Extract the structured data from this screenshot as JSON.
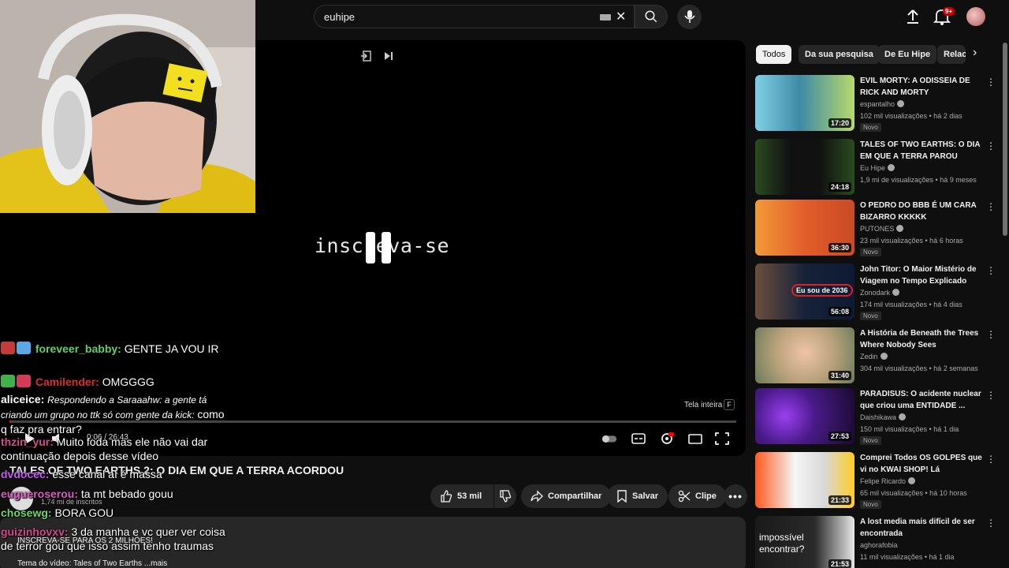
{
  "search": {
    "query": "euhipe"
  },
  "notifications": {
    "badge": "9+"
  },
  "player": {
    "overlay_text": "inscreva-se",
    "fullscreen_hint": "Tela inteira",
    "fullscreen_key": "F",
    "time": "0:06 / 26:43"
  },
  "video": {
    "title": "TALES OF TWO EARTHS 2: O DIA EM QUE A TERRA ACORDOU",
    "subscribers": "1,74 mi de inscritos",
    "likes": "53 mil",
    "share_label": "Compartilhar",
    "save_label": "Salvar",
    "clip_label": "Clipe"
  },
  "description": {
    "line1": "INSCREVA-SE PARA OS 2 MILHÕES!",
    "line2": "Tema do vídeo: Tales of Two Earths ...mais"
  },
  "chat": [
    {
      "user": "foreveer_babby:",
      "text": "GENTE JA VOU IR",
      "color": "#5ed16a"
    },
    {
      "user": "Camilender:",
      "text": "OMGGGG",
      "color": "#d72f2f"
    },
    {
      "user": "aliceice:",
      "reply": "Respondendo a Saraaahw: a gente tá criando um grupo no ttk só com gente da kick:",
      "text": "como q faz pra entrar?",
      "color": "#ffffff"
    },
    {
      "user": "thzin_yur:",
      "text": "Muito foda mas ele não vai dar continuação depois desse vídeo",
      "color": "#d1508a"
    },
    {
      "user": "dvdocec:",
      "text": "esse canal aí é massa",
      "color": "#c55ef0"
    },
    {
      "user": "eugueroserou:",
      "text": "ta mt bebado gouu",
      "color": "#d65fbd"
    },
    {
      "user": "chosewg:",
      "text": "BORA GOU",
      "color": "#6fd86a"
    },
    {
      "user": "guizinhovxv:",
      "text": "3 da manha e vc quer ver coisa de terror gou que isso assim tenho traumas",
      "color": "#d24a8c"
    }
  ],
  "chips": [
    "Todos",
    "Da sua pesquisa",
    "De Eu Hipe",
    "Relacionados"
  ],
  "recommendations": [
    {
      "title": "EVIL MORTY: A ODISSEIA DE RICK AND MORTY",
      "channel": "espantalho",
      "meta": "102 mil visualizações • há 2 dias",
      "duration": "17:20",
      "badge": "Novo"
    },
    {
      "title": "TALES OF TWO EARTHS: O DIA EM QUE A TERRA PAROU",
      "channel": "Eu Hipe",
      "meta": "1,9 mi de visualizações • há 9 meses",
      "duration": "24:18",
      "badge": ""
    },
    {
      "title": "O PEDRO DO BBB É UM CARA BIZARRO KKKKK",
      "channel": "PUTONES",
      "meta": "23 mil visualizações • há 6 horas",
      "duration": "36:30",
      "badge": "Novo"
    },
    {
      "title": "John Titor: O Maior Mistério de Viagem no Tempo Explicado",
      "channel": "Zonodark",
      "meta": "174 mil visualizações • há 4 dias",
      "duration": "56:08",
      "badge": "Novo",
      "thumb_text": "Eu sou de 2036"
    },
    {
      "title": "A História de Beneath the Trees Where Nobody Sees",
      "channel": "Zedin",
      "meta": "304 mil visualizações • há 2 semanas",
      "duration": "31:40",
      "badge": ""
    },
    {
      "title": "PARADISUS: O acidente nuclear que criou uma ENTIDADE ...",
      "channel": "Daishikawa",
      "meta": "150 mil visualizações • há 1 dia",
      "duration": "27:53",
      "badge": "Novo"
    },
    {
      "title": "Comprei Todos OS GOLPES que vi no KWAI SHOP! Lá Funciona...",
      "channel": "Felipe Ricardo",
      "meta": "65 mil visualizações • há 10 horas",
      "duration": "21:33",
      "badge": "Novo"
    },
    {
      "title": "A lost media mais difícil de ser encontrada",
      "channel": "aghorafobia",
      "meta": "11 mil visualizações • há 1 dia",
      "duration": "21:53",
      "badge": "",
      "thumb_text": "impossível encontrar?"
    }
  ]
}
